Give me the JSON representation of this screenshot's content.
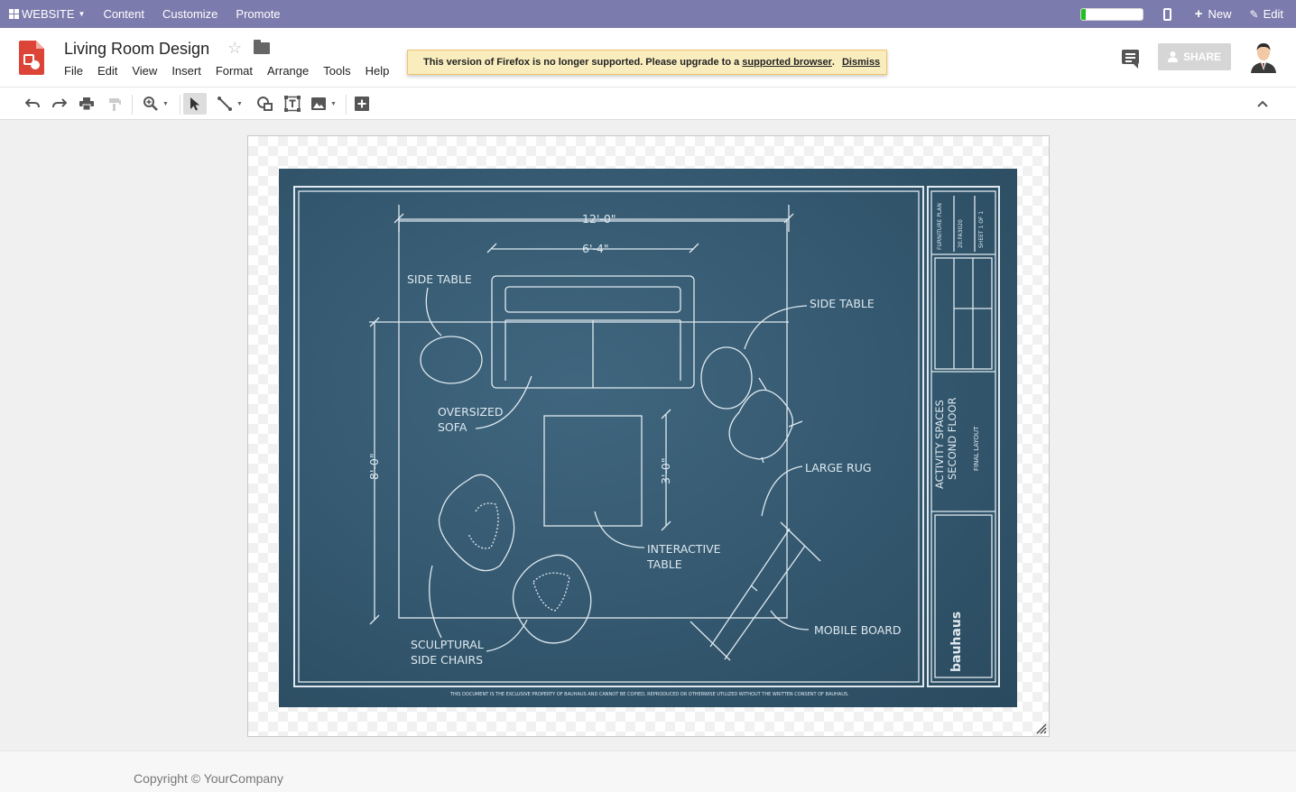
{
  "topbar": {
    "website_label": "WEBSITE",
    "content_label": "Content",
    "customize_label": "Customize",
    "promote_label": "Promote",
    "progress_fraction": 0.07,
    "new_label": "New",
    "edit_label": "Edit"
  },
  "doc": {
    "title": "Living Room Design",
    "menu": [
      "File",
      "Edit",
      "View",
      "Insert",
      "Format",
      "Arrange",
      "Tools",
      "Help"
    ]
  },
  "notice": {
    "message": "This version of Firefox is no longer supported. Please upgrade to a",
    "link_text": "supported browser",
    "period": ".",
    "dismiss_label": "Dismiss"
  },
  "share_label": "SHARE",
  "toolbar": {
    "icons": [
      "undo-icon",
      "redo-icon",
      "print-icon",
      "paint-format-icon",
      "zoom-icon",
      "select-icon",
      "line-icon",
      "shape-icon",
      "text-box-icon",
      "image-icon",
      "add-comment-icon",
      "collapse-icon"
    ]
  },
  "blueprint": {
    "dim_top": "12'-0\"",
    "dim_sofa": "6'-4\"",
    "dim_left": "8'-0\"",
    "dim_table": "3'-0\"",
    "label_side_table_left": "SIDE TABLE",
    "label_side_table_right": "SIDE TABLE",
    "label_sofa_1": "OVERSIZED",
    "label_sofa_2": "SOFA",
    "label_rug": "LARGE RUG",
    "label_table_1": "INTERACTIVE",
    "label_table_2": "TABLE",
    "label_chairs_1": "SCULPTURAL",
    "label_chairs_2": "SIDE CHAIRS",
    "label_board": "MOBILE BOARD",
    "titleblock_1": "ACTIVITY SPACES",
    "titleblock_2": "SECOND FLOOR",
    "titleblock_3": "FINAL LAYOUT",
    "brand": "bauhaus",
    "tb_cell_1": "FURNITURE PLAN",
    "tb_cell_2": "20.FA3020",
    "tb_cell_3": "SHEET 1 OF 1",
    "footer_note": "THIS DOCUMENT IS THE EXCLUSIVE PROPERTY OF BAUHAUS AND CANNOT BE COPIED, REPRODUCED OR OTHERWISE UTILIZED WITHOUT THE WRITTEN CONSENT OF BAUHAUS."
  },
  "footer": {
    "copyright": "Copyright © YourCompany"
  }
}
